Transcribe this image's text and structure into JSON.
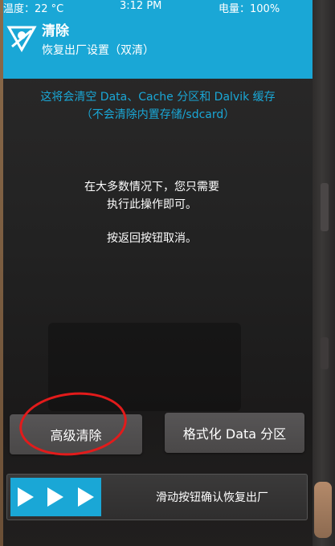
{
  "status_bar": {
    "temperature": "温度：22 °C",
    "time": "3:12 PM",
    "battery": "电量：100%"
  },
  "header": {
    "title": "清除",
    "subtitle": "恢复出厂设置（双清）"
  },
  "notice": {
    "line1": "这将会清空 Data、Cache 分区和 Dalvik 缓存",
    "line2": "（不会清除内置存储/sdcard）"
  },
  "body": {
    "line1": "在大多数情况下，您只需要",
    "line2": "执行此操作即可。",
    "line3": "按返回按钮取消。"
  },
  "buttons": {
    "advanced_wipe": "高级清除",
    "format_data": "格式化 Data 分区"
  },
  "swipe": {
    "label": "滑动按钮确认恢复出厂"
  },
  "colors": {
    "accent": "#1aa7d6",
    "highlight": "#e21b1b"
  }
}
